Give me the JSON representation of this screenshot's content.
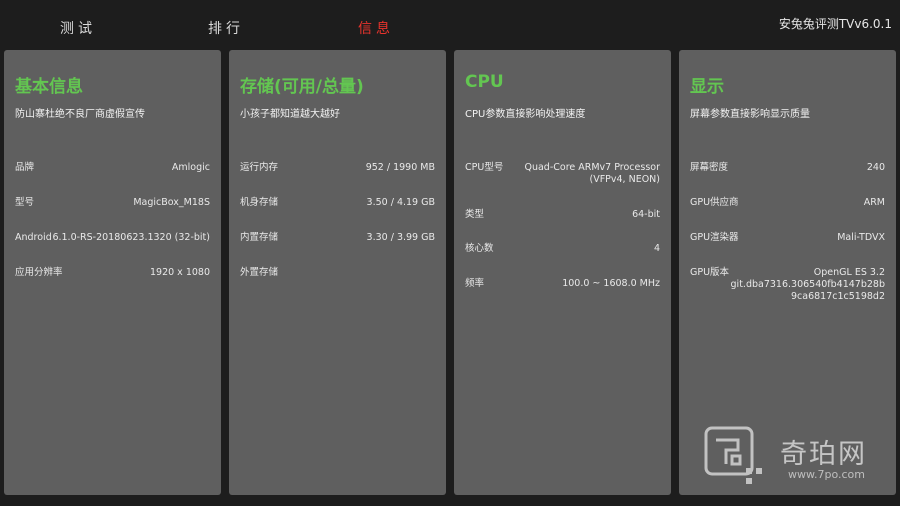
{
  "tabs": [
    {
      "label": "测试",
      "active": false
    },
    {
      "label": "排行",
      "active": false
    },
    {
      "label": "信息",
      "active": true
    }
  ],
  "app_title": "安兔兔评测TVv6.0.1",
  "colors": {
    "background": "#1d1d1d",
    "panel": "#5f5f5f",
    "accent_green": "#63c651",
    "active_tab": "#e8332c"
  },
  "panels": [
    {
      "title": "基本信息",
      "subtitle": "防山寨杜绝不良厂商虚假宣传",
      "rows": [
        {
          "label": "品牌",
          "value": "Amlogic"
        },
        {
          "label": "型号",
          "value": "MagicBox_M18S"
        },
        {
          "label": "Android",
          "value": "6.1.0-RS-20180623.1320 (32-bit)"
        },
        {
          "label": "应用分辨率",
          "value": "1920 x 1080"
        }
      ]
    },
    {
      "title": "存储(可用/总量)",
      "subtitle": "小孩子都知道越大越好",
      "rows": [
        {
          "label": "运行内存",
          "value": "952 / 1990 MB"
        },
        {
          "label": "机身存储",
          "value": "3.50 / 4.19 GB"
        },
        {
          "label": "内置存储",
          "value": "3.30 / 3.99 GB"
        },
        {
          "label": "外置存储",
          "value": ""
        }
      ]
    },
    {
      "title": "CPU",
      "subtitle": "CPU参数直接影响处理速度",
      "rows": [
        {
          "label": "CPU型号",
          "value": "Quad-Core ARMv7 Processor\n(VFPv4, NEON)"
        },
        {
          "label": "类型",
          "value": "64-bit"
        },
        {
          "label": "核心数",
          "value": "4"
        },
        {
          "label": "频率",
          "value": "100.0 ~ 1608.0 MHz"
        }
      ]
    },
    {
      "title": "显示",
      "subtitle": "屏幕参数直接影响显示质量",
      "rows": [
        {
          "label": "屏幕密度",
          "value": "240"
        },
        {
          "label": "GPU供应商",
          "value": "ARM"
        },
        {
          "label": "GPU渲染器",
          "value": "Mali-TDVX"
        },
        {
          "label": "GPU版本",
          "value": "OpenGL ES 3.2\ngit.dba7316.306540fb4147b28b\n9ca6817c1c5198d2"
        }
      ]
    }
  ],
  "watermark": {
    "name": "奇珀网",
    "url": "www.7po.com"
  }
}
